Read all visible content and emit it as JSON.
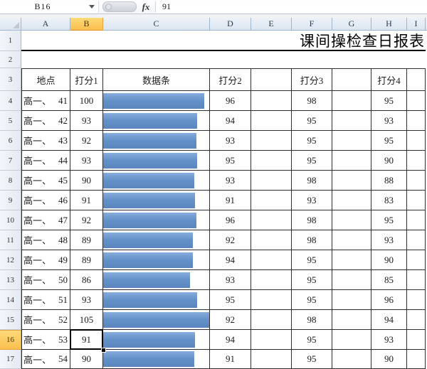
{
  "formula_bar": {
    "name_box": "B16",
    "fx_label": "fx",
    "formula_value": "91"
  },
  "sheet": {
    "title": "课间操检查日报表",
    "column_headers": [
      "A",
      "B",
      "C",
      "D",
      "E",
      "F",
      "G",
      "H",
      "I"
    ],
    "selected_cell": "B16",
    "selected_column": "B",
    "selected_row_header": 16,
    "empty_row_labels": [
      "1",
      "2"
    ],
    "table_header": {
      "location": "地点",
      "score1": "打分1",
      "databar": "数据条",
      "score2": "打分2",
      "score3": "打分3",
      "score4": "打分4"
    },
    "databar_max": 105,
    "databar_color": "#6190c8",
    "header_highlight_color": "#fbbf4e",
    "rows": [
      {
        "row": 4,
        "location": "高一、41",
        "score1": 100,
        "score2": 96,
        "score3": 98,
        "score4": 95
      },
      {
        "row": 5,
        "location": "高一、42",
        "score1": 93,
        "score2": 94,
        "score3": 95,
        "score4": 93
      },
      {
        "row": 6,
        "location": "高一、43",
        "score1": 92,
        "score2": 93,
        "score3": 95,
        "score4": 95
      },
      {
        "row": 7,
        "location": "高一、44",
        "score1": 93,
        "score2": 95,
        "score3": 95,
        "score4": 90
      },
      {
        "row": 8,
        "location": "高一、45",
        "score1": 90,
        "score2": 93,
        "score3": 98,
        "score4": 88
      },
      {
        "row": 9,
        "location": "高一、46",
        "score1": 91,
        "score2": 91,
        "score3": 93,
        "score4": 83
      },
      {
        "row": 10,
        "location": "高一、47",
        "score1": 92,
        "score2": 96,
        "score3": 98,
        "score4": 95
      },
      {
        "row": 11,
        "location": "高一、48",
        "score1": 89,
        "score2": 92,
        "score3": 98,
        "score4": 93
      },
      {
        "row": 12,
        "location": "高一、49",
        "score1": 89,
        "score2": 94,
        "score3": 95,
        "score4": 90
      },
      {
        "row": 13,
        "location": "高一、50",
        "score1": 86,
        "score2": 93,
        "score3": 95,
        "score4": 85
      },
      {
        "row": 14,
        "location": "高一、51",
        "score1": 93,
        "score2": 95,
        "score3": 95,
        "score4": 96
      },
      {
        "row": 15,
        "location": "高一、52",
        "score1": 105,
        "score2": 92,
        "score3": 98,
        "score4": 94
      },
      {
        "row": 16,
        "location": "高一、53",
        "score1": 91,
        "score2": 94,
        "score3": 95,
        "score4": 93
      },
      {
        "row": 17,
        "location": "高一、54",
        "score1": 90,
        "score2": 91,
        "score3": 95,
        "score4": 90
      }
    ]
  }
}
